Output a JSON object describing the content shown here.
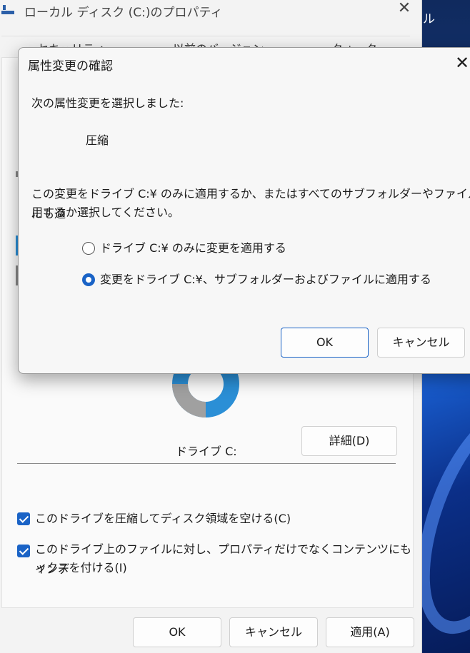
{
  "desktop": {
    "text": "ル"
  },
  "properties": {
    "title": "ローカル ディスク (C:)のプロパティ",
    "close_glyph": "✕",
    "tabs": [
      "セキュリティ",
      "以前のバージョン",
      "クォータ"
    ],
    "drive_label": "ドライブ C:",
    "detail_button": "詳細(D)",
    "checkboxes": [
      {
        "label": "このドライブを圧縮してディスク領域を空ける(C)",
        "checked": true
      },
      {
        "label_line1": "このドライブ上のファイルに対し、プロパティだけでなくコンテンツにもインデ",
        "label_line2": "ックスを付ける(I)",
        "checked": true
      }
    ],
    "buttons": {
      "ok": "OK",
      "cancel": "キャンセル",
      "apply": "適用(A)"
    },
    "colors": {
      "used": "#2b8fd6",
      "free": "#a0a0a0"
    }
  },
  "dialog": {
    "title": "属性変更の確認",
    "close_glyph": "✕",
    "intro": "次の属性変更を選択しました:",
    "attribute": "圧縮",
    "question_line1": "この変更をドライブ C:¥ のみに適用するか、またはすべてのサブフォルダーやファイルにも適",
    "question_line2": "用するか選択してください。",
    "options": [
      {
        "label": "ドライブ C:¥ のみに変更を適用する",
        "selected": false
      },
      {
        "label": "変更をドライブ C:¥、サブフォルダーおよびファイルに適用する",
        "selected": true
      }
    ],
    "ok": "OK",
    "cancel": "キャンセル",
    "accent": "#1a63c6"
  }
}
